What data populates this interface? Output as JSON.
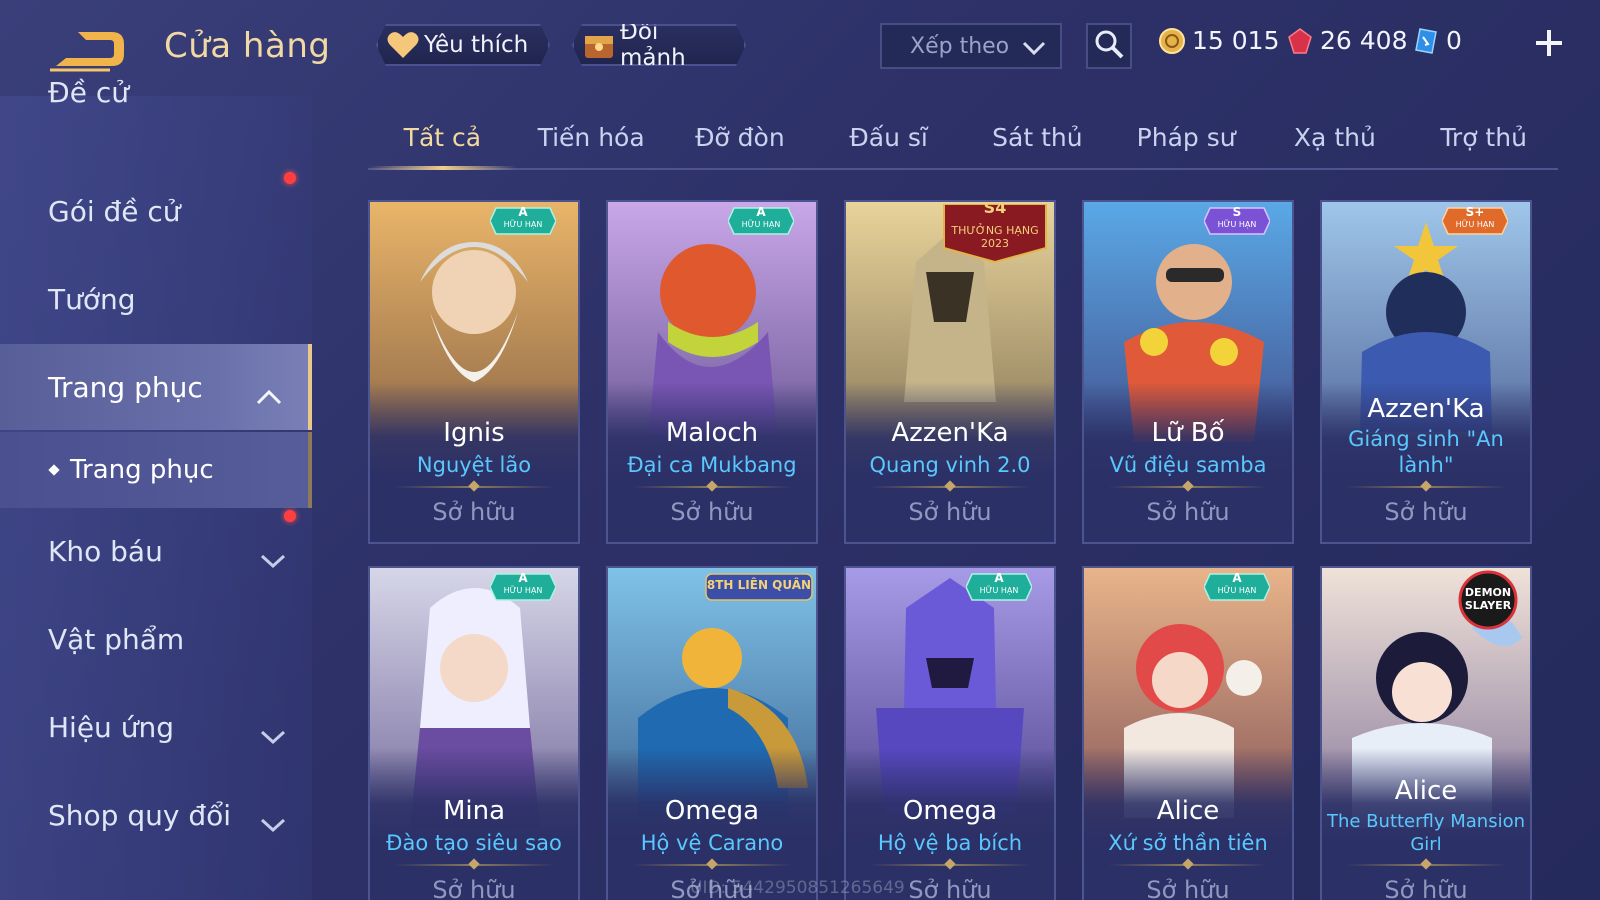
{
  "header": {
    "title": "Cửa hàng",
    "favorites_label": "Yêu thích",
    "shards_label": "Đổi mảnh",
    "sort_placeholder": "Xếp theo",
    "currency": {
      "gold": "15 015",
      "ruby": "26 408",
      "voucher": "0"
    }
  },
  "sidebar": {
    "cut_item": "Đề cử",
    "items": [
      {
        "label": "Gói đề cử"
      },
      {
        "label": "Tướng"
      },
      {
        "label": "Trang phục"
      },
      {
        "label": "Kho báu"
      },
      {
        "label": "Vật phẩm"
      },
      {
        "label": "Hiệu ứng"
      },
      {
        "label": "Shop quy đổi"
      }
    ],
    "sub_item": "Trang phục"
  },
  "tabs": [
    "Tất cả",
    "Tiến hóa",
    "Đỡ đòn",
    "Đấu sĩ",
    "Sát thủ",
    "Pháp sư",
    "Xạ thủ",
    "Trợ thủ"
  ],
  "cards": [
    {
      "hero": "Ignis",
      "skin": "Nguyệt lão",
      "status": "Sở hữu",
      "tier": "A",
      "tier_sub": "HỮU HẠN"
    },
    {
      "hero": "Maloch",
      "skin": "Đại ca Mukbang",
      "status": "Sở hữu",
      "tier": "A",
      "tier_sub": "HỮU HẠN"
    },
    {
      "hero": "Azzen'Ka",
      "skin": "Quang vinh 2.0",
      "status": "Sở hữu",
      "tier": "S4",
      "tier_sub": "THƯỞNG HẠNG 2023"
    },
    {
      "hero": "Lữ Bố",
      "skin": "Vũ điệu samba",
      "status": "Sở hữu",
      "tier": "S",
      "tier_sub": "HỮU HẠN"
    },
    {
      "hero": "Azzen'Ka",
      "skin": "Giáng sinh \"An lành\"",
      "status": "Sở hữu",
      "tier": "S+",
      "tier_sub": "HỮU HẠN"
    },
    {
      "hero": "Mina",
      "skin": "Đào tạo siêu sao",
      "status": "Sở hữu",
      "tier": "A",
      "tier_sub": "HỮU HẠN"
    },
    {
      "hero": "Omega",
      "skin": "Hộ vệ Carano",
      "status": "Sở hữu",
      "tier": "",
      "tier_sub": "8TH LIÊN QUÂN"
    },
    {
      "hero": "Omega",
      "skin": "Hộ vệ ba bích",
      "status": "Sở hữu",
      "tier": "A",
      "tier_sub": "HỮU HẠN"
    },
    {
      "hero": "Alice",
      "skin": "Xứ sở thần tiên",
      "status": "Sở hữu",
      "tier": "A",
      "tier_sub": "HỮU HẠN"
    },
    {
      "hero": "Alice",
      "skin": "The Butterfly Mansion Girl",
      "status": "Sở hữu",
      "tier": "",
      "tier_sub": "DEMON SLAYER"
    }
  ],
  "watermark": "UID: 5442950851265649",
  "colors": {
    "accent_gold": "#f0d9a4",
    "skin_name_blue": "#59c8ff",
    "notification_red": "#ff3f3f",
    "owned_grey": "#8f98bf"
  }
}
